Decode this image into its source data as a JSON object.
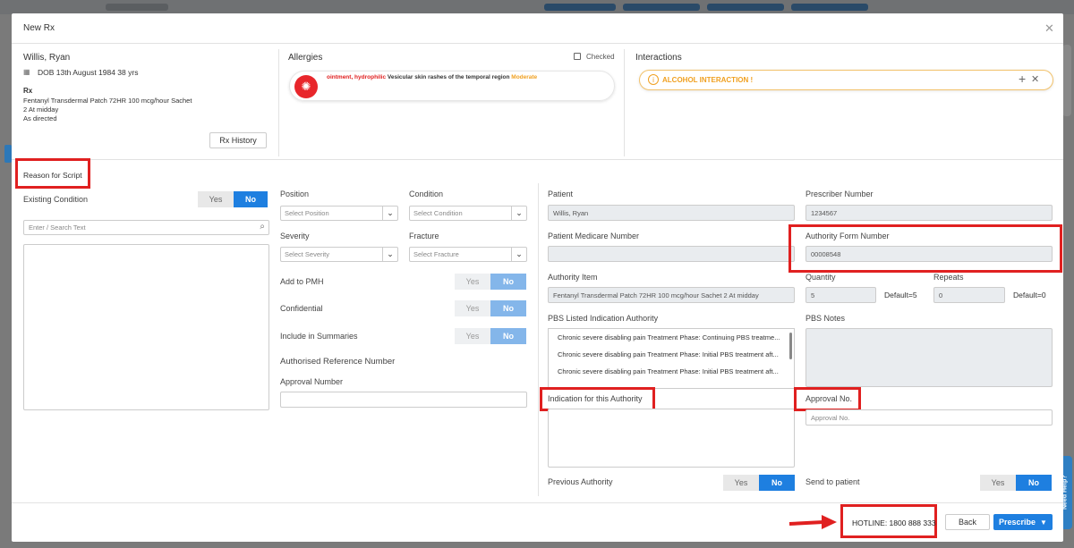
{
  "modal": {
    "title": "New Rx",
    "close_icon": "close-icon"
  },
  "patient": {
    "name": "Willis, Ryan",
    "dob": "DOB 13th August 1984 38 yrs",
    "rx_label": "Rx",
    "rx_lines": [
      "Fentanyl Transdermal Patch 72HR 100 mcg/hour Sachet",
      "2 At midday",
      "As directed"
    ],
    "rx_history_label": "Rx History"
  },
  "allergies": {
    "title": "Allergies",
    "checked_label": "Checked",
    "item": {
      "substance": "ointment, hydrophilic",
      "reaction": "Vesicular skin rashes of the temporal region",
      "severity": "Moderate"
    }
  },
  "interactions": {
    "title": "Interactions",
    "alert": "ALCOHOL INTERACTION !"
  },
  "reason": {
    "title": "Reason for Script",
    "existing_condition_label": "Existing Condition",
    "search_placeholder": "Enter / Search Text",
    "position_label": "Position",
    "position_placeholder": "Select Position",
    "condition_label": "Condition",
    "condition_placeholder": "Select Condition",
    "severity_label": "Severity",
    "severity_placeholder": "Select Severity",
    "fracture_label": "Fracture",
    "fracture_placeholder": "Select Fracture",
    "add_to_pmh_label": "Add to PMH",
    "confidential_label": "Confidential",
    "include_summaries_label": "Include in Summaries",
    "auth_ref_label": "Authorised Reference Number",
    "approval_number_label": "Approval Number",
    "yes": "Yes",
    "no": "No"
  },
  "authority": {
    "patient_label": "Patient",
    "patient_value": "Willis, Ryan",
    "prescriber_label": "Prescriber Number",
    "prescriber_value": "1234567",
    "medicare_label": "Patient Medicare Number",
    "medicare_value": "",
    "form_number_label": "Authority Form Number",
    "form_number_value": "00008548",
    "item_label": "Authority Item",
    "item_value": "Fentanyl Transdermal Patch 72HR 100 mcg/hour Sachet 2 At midday",
    "quantity_label": "Quantity",
    "quantity_value": "5",
    "quantity_default": "Default=5",
    "repeats_label": "Repeats",
    "repeats_value": "0",
    "repeats_default": "Default=0",
    "pbs_indication_label": "PBS Listed Indication Authority",
    "pbs_indications": [
      "Chronic severe disabling pain Treatment Phase: Continuing PBS treatme...",
      "Chronic severe disabling pain Treatment Phase: Initial PBS treatment aft...",
      "Chronic severe disabling pain Treatment Phase: Initial PBS treatment aft..."
    ],
    "pbs_notes_label": "PBS Notes",
    "indication_label": "Indication for this Authority",
    "approval_label": "Approval No.",
    "approval_placeholder": "Approval No.",
    "previous_authority_label": "Previous Authority",
    "send_to_patient_label": "Send to patient"
  },
  "footer": {
    "hotline": "HOTLINE: 1800 888 333",
    "back_label": "Back",
    "prescribe_label": "Prescribe"
  },
  "side": {
    "need_help": "Need Help?"
  },
  "colors": {
    "accent": "#1e7fe0",
    "danger": "#e02020",
    "warning": "#f0a020"
  }
}
